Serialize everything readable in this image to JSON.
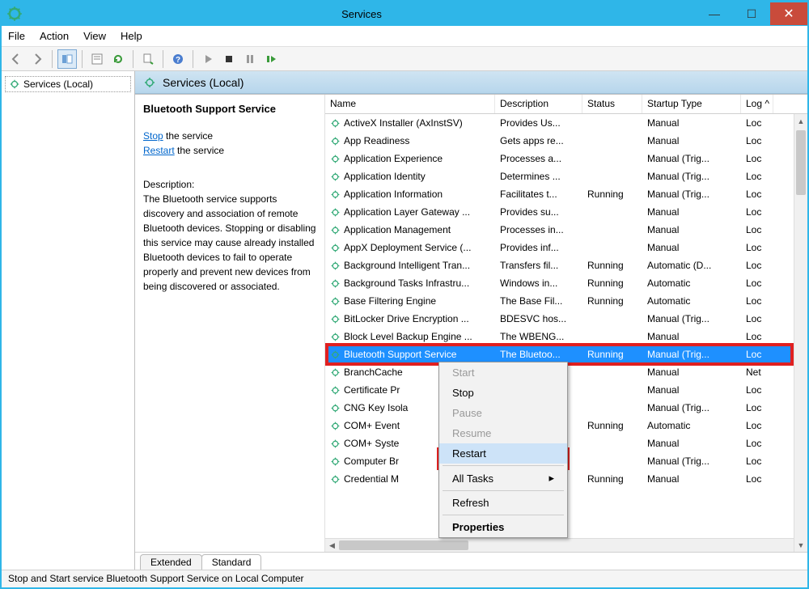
{
  "window": {
    "title": "Services"
  },
  "menubar": [
    "File",
    "Action",
    "View",
    "Help"
  ],
  "left": {
    "label": "Services (Local)"
  },
  "header": {
    "title": "Services (Local)"
  },
  "detail": {
    "name": "Bluetooth Support Service",
    "stop": "Stop",
    "stop_suffix": " the service",
    "restart": "Restart",
    "restart_suffix": " the service",
    "desc_label": "Description:",
    "desc": "The Bluetooth service supports discovery and association of remote Bluetooth devices.  Stopping or disabling this service may cause already installed Bluetooth devices to fail to operate properly and prevent new devices from being discovered or associated."
  },
  "columns": {
    "name": "Name",
    "desc": "Description",
    "status": "Status",
    "type": "Startup Type",
    "log": "Log"
  },
  "rows": [
    {
      "name": "ActiveX Installer (AxInstSV)",
      "desc": "Provides Us...",
      "status": "",
      "type": "Manual",
      "log": "Loc"
    },
    {
      "name": "App Readiness",
      "desc": "Gets apps re...",
      "status": "",
      "type": "Manual",
      "log": "Loc"
    },
    {
      "name": "Application Experience",
      "desc": "Processes a...",
      "status": "",
      "type": "Manual (Trig...",
      "log": "Loc"
    },
    {
      "name": "Application Identity",
      "desc": "Determines ...",
      "status": "",
      "type": "Manual (Trig...",
      "log": "Loc"
    },
    {
      "name": "Application Information",
      "desc": "Facilitates t...",
      "status": "Running",
      "type": "Manual (Trig...",
      "log": "Loc"
    },
    {
      "name": "Application Layer Gateway ...",
      "desc": "Provides su...",
      "status": "",
      "type": "Manual",
      "log": "Loc"
    },
    {
      "name": "Application Management",
      "desc": "Processes in...",
      "status": "",
      "type": "Manual",
      "log": "Loc"
    },
    {
      "name": "AppX Deployment Service (...",
      "desc": "Provides inf...",
      "status": "",
      "type": "Manual",
      "log": "Loc"
    },
    {
      "name": "Background Intelligent Tran...",
      "desc": "Transfers fil...",
      "status": "Running",
      "type": "Automatic (D...",
      "log": "Loc"
    },
    {
      "name": "Background Tasks Infrastru...",
      "desc": "Windows in...",
      "status": "Running",
      "type": "Automatic",
      "log": "Loc"
    },
    {
      "name": "Base Filtering Engine",
      "desc": "The Base Fil...",
      "status": "Running",
      "type": "Automatic",
      "log": "Loc"
    },
    {
      "name": "BitLocker Drive Encryption ...",
      "desc": "BDESVC hos...",
      "status": "",
      "type": "Manual (Trig...",
      "log": "Loc"
    },
    {
      "name": "Block Level Backup Engine ...",
      "desc": "The WBENG...",
      "status": "",
      "type": "Manual",
      "log": "Loc"
    },
    {
      "name": "Bluetooth Support Service",
      "desc": "The Bluetoo...",
      "status": "Running",
      "type": "Manual (Trig...",
      "log": "Loc",
      "selected": true
    },
    {
      "name": "BranchCache",
      "desc": "",
      "status": "",
      "type": "Manual",
      "log": "Net"
    },
    {
      "name": "Certificate Pr",
      "desc": "",
      "status": "",
      "type": "Manual",
      "log": "Loc"
    },
    {
      "name": "CNG Key Isola",
      "desc": "",
      "status": "",
      "type": "Manual (Trig...",
      "log": "Loc"
    },
    {
      "name": "COM+ Event",
      "desc": "",
      "status": "Running",
      "type": "Automatic",
      "log": "Loc"
    },
    {
      "name": "COM+ Syste",
      "desc": "",
      "status": "",
      "type": "Manual",
      "log": "Loc"
    },
    {
      "name": "Computer Br",
      "desc": "",
      "status": "",
      "type": "Manual (Trig...",
      "log": "Loc"
    },
    {
      "name": "Credential M",
      "desc": "",
      "status": "Running",
      "type": "Manual",
      "log": "Loc"
    }
  ],
  "context_menu": {
    "start": "Start",
    "stop": "Stop",
    "pause": "Pause",
    "resume": "Resume",
    "restart": "Restart",
    "alltasks": "All Tasks",
    "refresh": "Refresh",
    "properties": "Properties"
  },
  "tabs": {
    "extended": "Extended",
    "standard": "Standard"
  },
  "statusbar": "Stop and Start service Bluetooth Support Service on Local Computer"
}
